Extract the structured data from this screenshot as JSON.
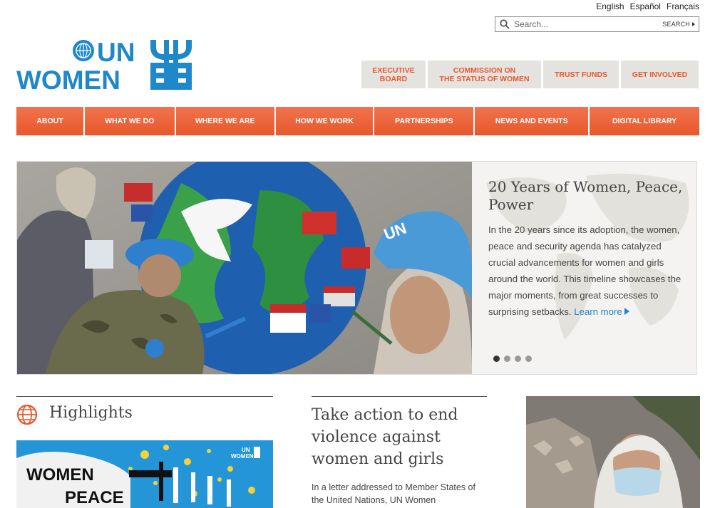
{
  "languages": [
    "English",
    "Español",
    "Français"
  ],
  "search": {
    "placeholder": "Search...",
    "button_label": "SEARCH"
  },
  "logo": {
    "line1": "UN",
    "line2": "WOMEN"
  },
  "utility_links": [
    {
      "line1": "EXECUTIVE",
      "line2": "BOARD"
    },
    {
      "line1": "COMMISSION ON",
      "line2": "THE STATUS OF WOMEN"
    },
    {
      "line1": "TRUST FUNDS",
      "line2": ""
    },
    {
      "line1": "GET INVOLVED",
      "line2": ""
    }
  ],
  "nav": [
    "ABOUT",
    "WHAT WE DO",
    "WHERE WE ARE",
    "HOW WE WORK",
    "PARTNERSHIPS",
    "NEWS AND EVENTS",
    "DIGITAL LIBRARY"
  ],
  "hero": {
    "title": "20 Years of Women, Peace, Power",
    "body": "In the 20 years since its adoption, the women, peace and security agenda has catalyzed crucial advancements for women and girls around the world. This timeline showcases the major moments, from great successes to surprising setbacks.",
    "more": "Learn more",
    "slide_count": 4,
    "active_slide": 1,
    "helmet_letters": "UN"
  },
  "highlights": {
    "title": "Highlights",
    "banner_line1": "WOMEN",
    "banner_line2": "PEACE",
    "banner_logo_line1": "UN",
    "banner_logo_line2": "WOMEN"
  },
  "feature": {
    "title": "Take action to end violence against women and girls",
    "text": "In a letter addressed to Member States of the United Nations, UN Women"
  },
  "colors": {
    "accent": "#e8582e",
    "brand_blue": "#1e88c9",
    "util_bg": "#e5e3df",
    "panel_bg": "#f4f3f1"
  }
}
